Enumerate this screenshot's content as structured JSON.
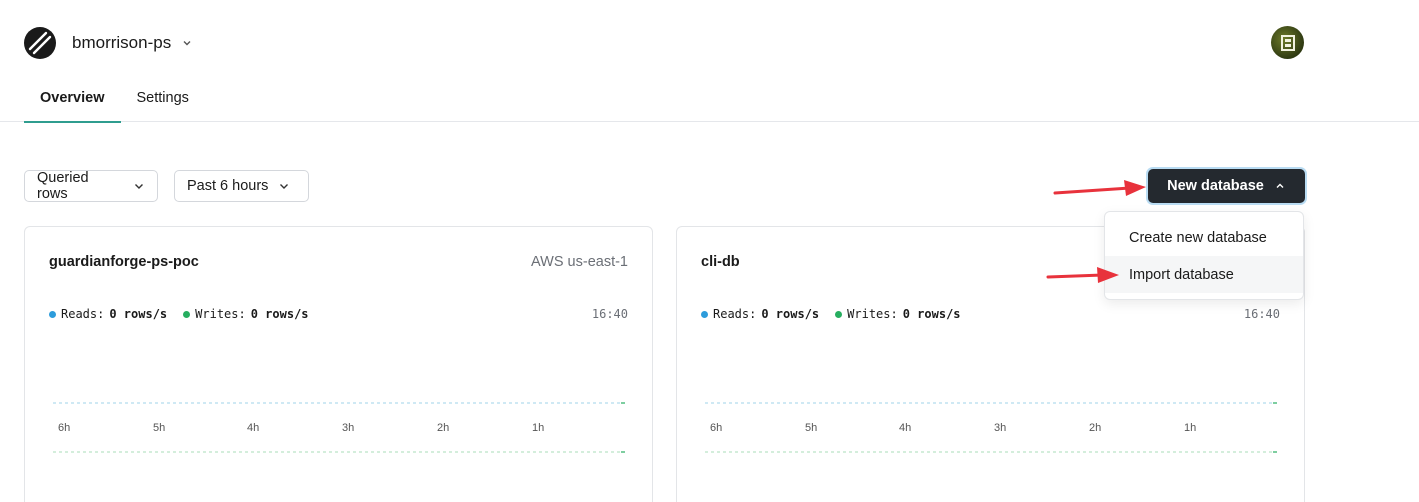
{
  "header": {
    "org_name": "bmorrison-ps",
    "logo_icon": "planetscale-logo-icon",
    "avatar_icon": "user-avatar-icon"
  },
  "tabs": [
    {
      "label": "Overview",
      "active": true
    },
    {
      "label": "Settings",
      "active": false
    }
  ],
  "filters": {
    "metric": "Queried rows",
    "range": "Past 6 hours"
  },
  "new_database": {
    "label": "New database",
    "menu": [
      {
        "label": "Create new database"
      },
      {
        "label": "Import database"
      }
    ]
  },
  "databases": [
    {
      "name": "guardianforge-ps-poc",
      "region": "AWS us-east-1",
      "reads_label": "Reads:",
      "reads_value": "0 rows/s",
      "writes_label": "Writes:",
      "writes_value": "0 rows/s",
      "time": "16:40",
      "ticks": [
        "6h",
        "5h",
        "4h",
        "3h",
        "2h",
        "1h"
      ]
    },
    {
      "name": "cli-db",
      "region": "",
      "reads_label": "Reads:",
      "reads_value": "0 rows/s",
      "writes_label": "Writes:",
      "writes_value": "0 rows/s",
      "time": "16:40",
      "ticks": [
        "6h",
        "5h",
        "4h",
        "3h",
        "2h",
        "1h"
      ]
    }
  ],
  "colors": {
    "reads": "#2d9cdb",
    "writes": "#27ae60",
    "arrow": "#e8323c",
    "button": "#24292f",
    "tab_underline": "#2f9d8f"
  }
}
